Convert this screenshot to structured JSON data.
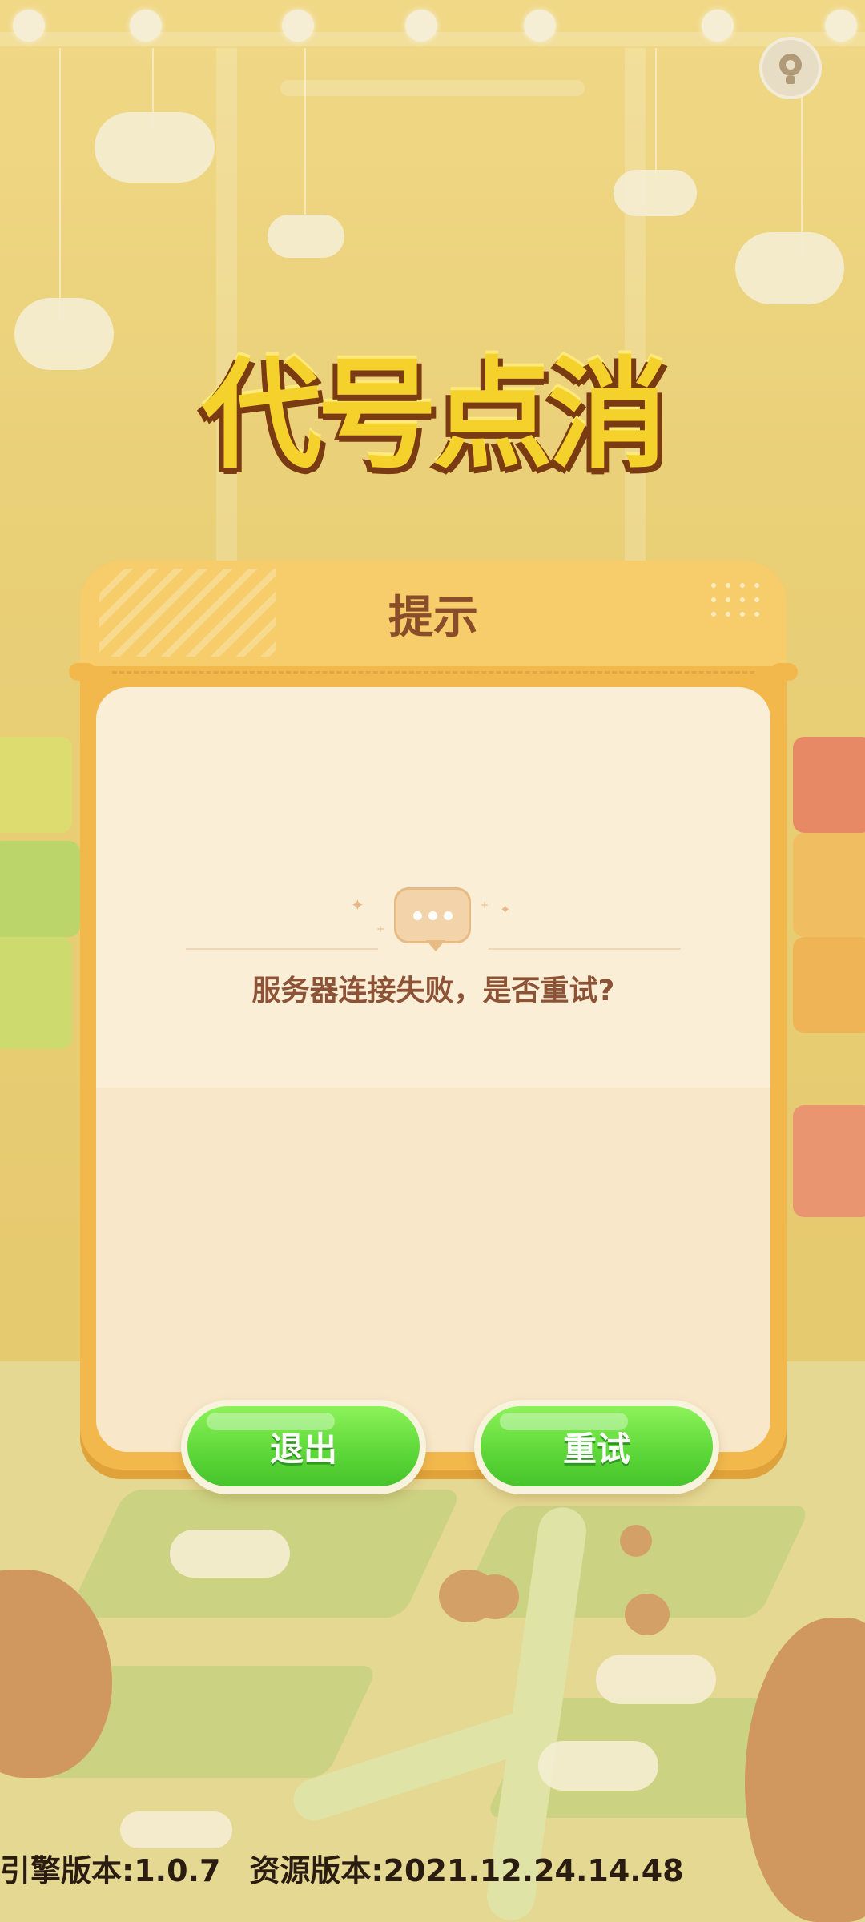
{
  "logo": {
    "text": "代号点消"
  },
  "dialog": {
    "title": "提示",
    "message": "服务器连接失败，是否重试?",
    "buttons": {
      "exit": "退出",
      "retry": "重试"
    }
  },
  "footer": {
    "engine_version": "引擎版本:1.0.7",
    "resource_version": "资源版本:2021.12.24.14.48"
  },
  "icons": {
    "settings": "gear-icon",
    "chat": "chat-bubble-icon"
  },
  "colors": {
    "dialog_frame": "#f2b84c",
    "dialog_body": "#fbeed6",
    "title_text": "#8a4d2a",
    "message_text": "#8c5336",
    "button_green": "#5fd93a"
  }
}
